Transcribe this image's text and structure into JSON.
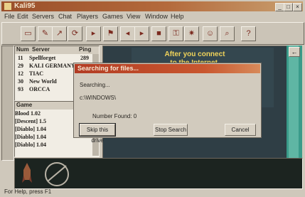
{
  "window": {
    "title": "Kali95",
    "controls": [
      "_",
      "□",
      "×"
    ]
  },
  "menu": [
    "File",
    "Edit",
    "Servers",
    "Chat",
    "Players",
    "Games",
    "View",
    "Window",
    "Help"
  ],
  "toolbar": {
    "buttons": [
      "new-icon",
      "tool-icon",
      "arrow-icon",
      "refresh-icon",
      "play-icon",
      "flag-icon",
      "left-icon",
      "right-icon",
      "stop-icon",
      "key-icon",
      "gear-icon",
      "people-icon",
      "search-icon",
      "help-icon"
    ]
  },
  "servers": {
    "columns": [
      "Num",
      "Server",
      "Ping"
    ],
    "rows": [
      {
        "num": "11",
        "name": "Spellforget",
        "ping": "289"
      },
      {
        "num": "29",
        "name": "KALI GERMANY",
        "ping": ""
      },
      {
        "num": "12",
        "name": "TIAC",
        "ping": ""
      },
      {
        "num": "30",
        "name": "New World",
        "ping": ""
      },
      {
        "num": "93",
        "name": "ORCCA",
        "ping": ""
      }
    ]
  },
  "games": {
    "header": "Game",
    "rows": [
      "Blood 1.02",
      "[Descent] 1.5",
      "[Diablo] 1.04",
      "[Diablo] 1.04",
      "[Diablo] 1.04"
    ]
  },
  "content": {
    "line1": "After you connect",
    "line2": "to the Internet."
  },
  "dialog": {
    "title": "Searching for files...",
    "status": "Searching...",
    "path": "c:\\WINDOWS\\",
    "found": "Number Found: 0",
    "buttons": [
      "Skip this drive",
      "Stop Search",
      "Cancel"
    ]
  },
  "statusbar": "For Help, press F1",
  "colors": {
    "titlebar": "#9a4f2a",
    "dialog_titlebar": "#b23c24",
    "notice_text": "#f0d35a",
    "selection": "#2b2a8a"
  }
}
